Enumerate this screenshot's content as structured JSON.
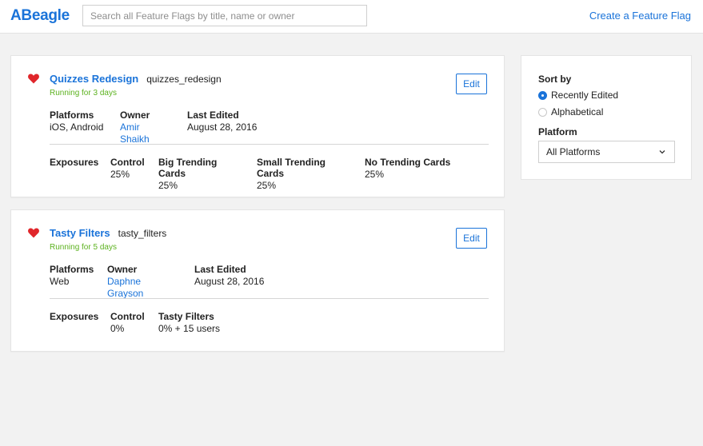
{
  "header": {
    "logo": "ABeagle",
    "search_placeholder": "Search all Feature Flags by title, name or owner",
    "create_link": "Create a Feature Flag"
  },
  "flags": [
    {
      "title": "Quizzes Redesign",
      "key": "quizzes_redesign",
      "status": "Running for 3 days",
      "edit_label": "Edit",
      "meta": [
        {
          "label": "Platforms",
          "value": "iOS, Android"
        },
        {
          "label": "Owner",
          "value": "Amir Shaikh"
        },
        {
          "label": "Last Edited",
          "value": "August 28, 2016"
        }
      ],
      "exposures_label": "Exposures",
      "variants": [
        {
          "name": "Control",
          "value": "25%"
        },
        {
          "name": "Big Trending Cards",
          "value": "25%"
        },
        {
          "name": "Small Trending Cards",
          "value": "25%"
        },
        {
          "name": "No Trending Cards",
          "value": "25%"
        }
      ]
    },
    {
      "title": "Tasty Filters",
      "key": "tasty_filters",
      "status": "Running for 5 days",
      "edit_label": "Edit",
      "meta": [
        {
          "label": "Platforms",
          "value": "Web"
        },
        {
          "label": "Owner",
          "value": "Daphne Grayson"
        },
        {
          "label": "Last Edited",
          "value": "August 28, 2016"
        }
      ],
      "exposures_label": "Exposures",
      "variants": [
        {
          "name": "Control",
          "value": "0%"
        },
        {
          "name": "Tasty Filters",
          "value": "0% + 15 users"
        }
      ]
    }
  ],
  "sidebar": {
    "sort_label": "Sort by",
    "sort_options": [
      {
        "label": "Recently Edited",
        "selected": true
      },
      {
        "label": "Alphabetical",
        "selected": false
      }
    ],
    "platform_label": "Platform",
    "platform_value": "All Platforms"
  },
  "colors": {
    "accent": "#1a73d9",
    "running": "#5cb21f",
    "heart": "#e0262b",
    "background": "#f2f2f2"
  },
  "icons": {
    "favorite": "heart-icon",
    "dropdown": "chevron-down-icon"
  }
}
